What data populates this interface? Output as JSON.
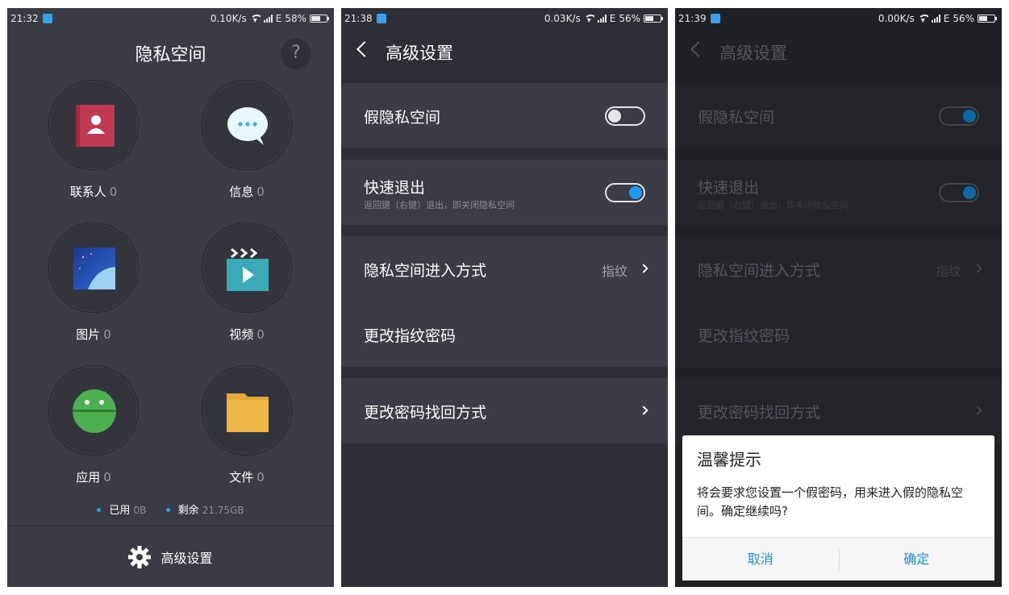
{
  "colors": {
    "accent": "#1e9bf0",
    "panel_bg": "#3a3b44"
  },
  "screen1": {
    "status": {
      "time": "21:32",
      "speed": "0.10K/s",
      "network": "E",
      "battery": "58%",
      "battery_level": 0.58
    },
    "title": "隐私空间",
    "help": "?",
    "tiles": [
      {
        "label": "联系人",
        "count": "0",
        "icon": "contacts-icon"
      },
      {
        "label": "信息",
        "count": "0",
        "icon": "messages-icon"
      },
      {
        "label": "图片",
        "count": "0",
        "icon": "gallery-icon"
      },
      {
        "label": "视频",
        "count": "0",
        "icon": "video-icon"
      },
      {
        "label": "应用",
        "count": "0",
        "icon": "android-icon"
      },
      {
        "label": "文件",
        "count": "0",
        "icon": "folder-icon"
      }
    ],
    "storage": {
      "used_label": "已用",
      "used_value": "0B",
      "free_label": "剩余",
      "free_value": "21.75GB"
    },
    "footer": {
      "label": "高级设置",
      "icon": "gear-icon"
    }
  },
  "screen2": {
    "status": {
      "time": "21:38",
      "speed": "0.03K/s",
      "network": "E",
      "battery": "56%",
      "battery_level": 0.56
    },
    "title": "高级设置",
    "fake_space": {
      "label": "假隐私空间",
      "enabled": false
    },
    "quick_exit": {
      "label": "快速退出",
      "sub": "返回键（右键）退出，即关闭隐私空间",
      "enabled": true
    },
    "entry_method": {
      "label": "隐私空间进入方式",
      "value": "指纹"
    },
    "change_fp": {
      "label": "更改指纹密码"
    },
    "recovery": {
      "label": "更改密码找回方式"
    }
  },
  "screen3": {
    "status": {
      "time": "21:39",
      "speed": "0.00K/s",
      "network": "E",
      "battery": "56%",
      "battery_level": 0.56
    },
    "title": "高级设置",
    "fake_space": {
      "label": "假隐私空间",
      "enabled": true
    },
    "quick_exit": {
      "label": "快速退出",
      "sub": "返回键（右键）退出，即关闭隐私空间",
      "enabled": true
    },
    "entry_method": {
      "label": "隐私空间进入方式",
      "value": "指纹"
    },
    "change_fp": {
      "label": "更改指纹密码"
    },
    "recovery": {
      "label": "更改密码找回方式"
    },
    "dialog": {
      "title": "温馨提示",
      "body": "将会要求您设置一个假密码，用来进入假的隐私空间。确定继续吗?",
      "cancel": "取消",
      "confirm": "确定"
    }
  }
}
